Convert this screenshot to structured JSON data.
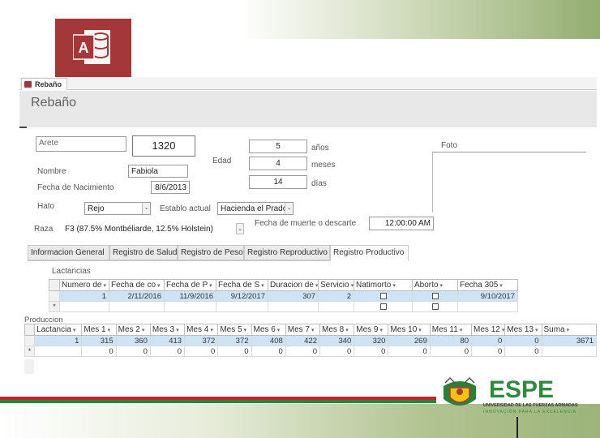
{
  "window": {
    "tab_label": "Rebaño",
    "form_title": "Rebaño"
  },
  "form": {
    "arete_label": "Arete",
    "arete_value": "1320",
    "nombre_label": "Nombre",
    "nombre_value": "Fabiola",
    "fecha_nac_label": "Fecha de Nacimiento",
    "fecha_nac_value": "8/6/2013",
    "hato_label": "Hato",
    "hato_value": "Rejo",
    "establo_label": "Establo actual",
    "establo_value": "Hacienda el Prado",
    "raza_label": "Raza",
    "raza_value": "F3 (87.5% Montbéliarde, 12.5% Holstein)",
    "edad_label": "Edad",
    "edad_anios_value": "5",
    "edad_anios_label": "años",
    "edad_meses_value": "4",
    "edad_meses_label": "meses",
    "edad_dias_value": "14",
    "edad_dias_label": "días",
    "foto_label": "Foto",
    "muerte_label": "Fecha de muerte o descarte",
    "muerte_value": "12:00:00 AM"
  },
  "tabs": [
    {
      "label": "Informacion General"
    },
    {
      "label": "Registro de Salud"
    },
    {
      "label": "Registro de Peso"
    },
    {
      "label": "Registro Reproductivo"
    },
    {
      "label": "Registro Productivo"
    }
  ],
  "lactancias": {
    "section_label": "Lactancias",
    "columns": [
      "Numero de",
      "Fecha de co",
      "Fecha de P",
      "Fecha de S",
      "Duracion de",
      "Servicio",
      "Natimorto",
      "Aborto",
      "Fecha 305"
    ],
    "row": {
      "numero": "1",
      "fecha_co": "2/11/2016",
      "fecha_p": "11/9/2016",
      "fecha_s": "9/12/2017",
      "duracion": "307",
      "servicio": "2",
      "fecha305": "9/10/2017"
    },
    "new_marker": "*"
  },
  "produccion": {
    "section_label": "Produccion",
    "columns": [
      "Lactancia",
      "Mes 1",
      "Mes 2",
      "Mes 3",
      "Mes 4",
      "Mes 5",
      "Mes 6",
      "Mes 7",
      "Mes 8",
      "Mes 9",
      "Mes 10",
      "Mes 11",
      "Mes 12",
      "Mes 13",
      "Suma"
    ],
    "row1": [
      "1",
      "315",
      "360",
      "413",
      "372",
      "372",
      "408",
      "422",
      "340",
      "320",
      "269",
      "80",
      "0",
      "0",
      "3671"
    ],
    "row2": [
      "",
      "0",
      "0",
      "0",
      "0",
      "0",
      "0",
      "0",
      "0",
      "0",
      "0",
      "0",
      "0",
      "0",
      ""
    ],
    "new_marker": "*"
  },
  "brand": {
    "access_letter": "A",
    "logo_name": "ESPE",
    "logo_line1": "UNIVERSIDAD DE LAS FUERZAS ARMADAS",
    "logo_line2": "INNOVACIÓN PARA LA EXCELENCIA",
    "accent_red": "#c1272d",
    "accent_green": "#1f8a3c",
    "access_color": "#a4373a"
  }
}
